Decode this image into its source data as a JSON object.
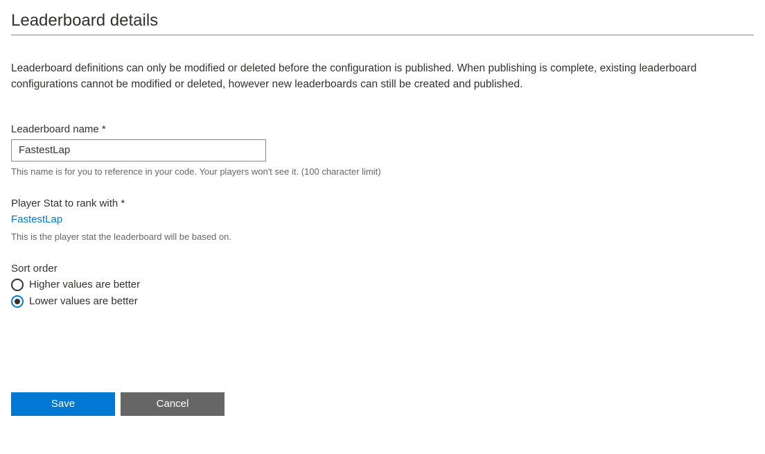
{
  "page": {
    "title": "Leaderboard details",
    "description": "Leaderboard definitions can only be modified or deleted before the configuration is published. When publishing is complete, existing leaderboard configurations cannot be modified or deleted, however new leaderboards can still be created and published."
  },
  "form": {
    "name_label": "Leaderboard name *",
    "name_value": "FastestLap",
    "name_helper": "This name is for you to reference in your code. Your players won't see it. (100 character limit)",
    "stat_label": "Player Stat to rank with *",
    "stat_value": "FastestLap",
    "stat_helper": "This is the player stat the leaderboard will be based on.",
    "sort_label": "Sort order",
    "sort_options": {
      "higher": "Higher values are better",
      "lower": "Lower values are better"
    },
    "sort_selected": "lower"
  },
  "buttons": {
    "save": "Save",
    "cancel": "Cancel"
  }
}
